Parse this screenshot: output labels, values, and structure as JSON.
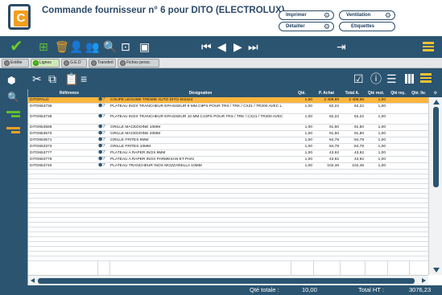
{
  "header": {
    "title": "Commande fournisseur n° 6 pour DITO (ELECTROLUX)",
    "buttons": {
      "imprimer": "Imprimer",
      "detailler": "Détailler",
      "ventilation": "Ventilation",
      "etiquettes": "Etiquettes"
    }
  },
  "logo_letter": "C",
  "tabs": [
    {
      "label": "Entête",
      "active": false
    },
    {
      "label": "Lignes",
      "active": true
    },
    {
      "label": "G.E.D",
      "active": false
    },
    {
      "label": "Transfert",
      "active": false
    },
    {
      "label": "Fiches perso.",
      "active": false
    }
  ],
  "table": {
    "headers": {
      "reference": "Référence",
      "designation": "Désignation",
      "qte": "Qté.",
      "prix_achat": "P. Achat",
      "total": "Total A.",
      "qte_rest": "Qté rest.",
      "qte_rec": "Qté reç.",
      "qte_liv": "Qté. liv."
    },
    "rows": [
      {
        "ref": "DITOPALD",
        "des": "COUPE LEGUME TREMIE AUTO DITO 603424",
        "qte": "1,00",
        "pa": "2 408,89",
        "tot": "2 408,89",
        "rest": "1,00",
        "selected": true,
        "lines": 1
      },
      {
        "ref": "DITO653736",
        "des": "PLATEAU INOX TRANCHEUR EPAISSEUR 8 MM C8PS POUR TRS / TRK / CX21 / TR200 AVEC L",
        "qte": "1,00",
        "pa": "62,22",
        "tot": "62,22",
        "rest": "1,00",
        "selected": false,
        "lines": 2
      },
      {
        "ref": "DITO653739",
        "des": "PLATEAU INOX TRANCHEUR EPAISSEUR 10 MM C10PS POUR TRS / TRK / CX21 / TR200 AVEC",
        "qte": "1,00",
        "pa": "62,22",
        "tot": "62,22",
        "rest": "1,00",
        "selected": false,
        "lines": 2
      },
      {
        "ref": "DITO653568",
        "des": "GRILLE MACEDOINE 10MM",
        "qte": "1,00",
        "pa": "91,50",
        "tot": "91,50",
        "rest": "1,00",
        "selected": false,
        "lines": 1
      },
      {
        "ref": "DITO653570",
        "des": "GRILLE MACEDOINE 20MM",
        "qte": "1,00",
        "pa": "91,50",
        "tot": "91,50",
        "rest": "1,00",
        "selected": false,
        "lines": 1
      },
      {
        "ref": "DITO653571",
        "des": "GRILLE FRITES 8MM",
        "qte": "1,00",
        "pa": "84,79",
        "tot": "84,79",
        "rest": "1,00",
        "selected": false,
        "lines": 1
      },
      {
        "ref": "DITO653373",
        "des": "GRILLE FRITES 10MM",
        "qte": "1,00",
        "pa": "84,79",
        "tot": "84,79",
        "rest": "1,00",
        "selected": false,
        "lines": 1
      },
      {
        "ref": "DITO653777",
        "des": "PLATEAU A RAPER INOX 9MM",
        "qte": "1,00",
        "pa": "43,92",
        "tot": "43,92",
        "rest": "1,00",
        "selected": false,
        "lines": 1
      },
      {
        "ref": "DITO653779",
        "des": "PLATEAU A RAPER INOX PARMESAN ET PAIN",
        "qte": "1,00",
        "pa": "43,92",
        "tot": "43,92",
        "rest": "1,00",
        "selected": false,
        "lines": 1
      },
      {
        "ref": "DITO653740",
        "des": "PLATEAU TRANCHEUR INOX MOZZARELLA 10MM",
        "qte": "1,00",
        "pa": "102,46",
        "tot": "102,46",
        "rest": "1,00",
        "selected": false,
        "lines": 1
      }
    ],
    "empty_rows": 19
  },
  "footer": {
    "qte_label": "Qté totale :",
    "qte_value": "10,00",
    "ht_label": "Total HT :",
    "ht_value": "3076,23"
  },
  "colors": {
    "primary": "#2b5471",
    "accent": "#f2a01f",
    "selected_row": "#f9b53c",
    "green": "#5fc12b"
  }
}
